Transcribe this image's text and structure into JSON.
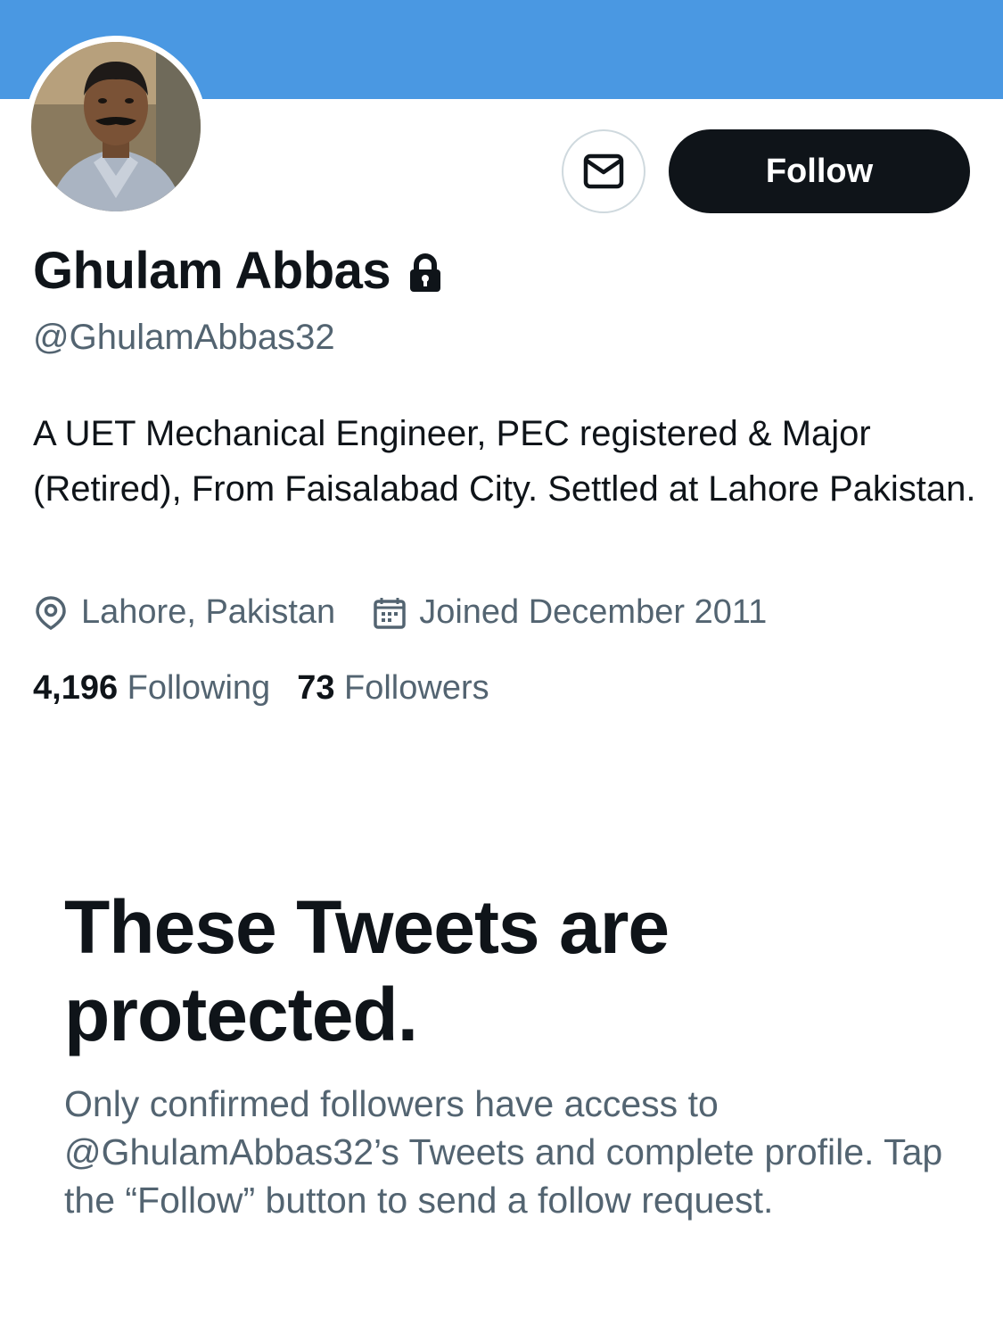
{
  "profile": {
    "name": "Ghulam Abbas",
    "handle": "@GhulamAbbas32",
    "bio": "A UET Mechanical Engineer, PEC registered & Major (Retired), From Faisalabad City. Settled at Lahore Pakistan.",
    "location": "Lahore, Pakistan",
    "joined": "Joined December 2011",
    "following_count": "4,196",
    "following_label": "Following",
    "followers_count": "73",
    "followers_label": "Followers",
    "protected": true
  },
  "actions": {
    "follow_label": "Follow",
    "message_icon": "envelope-icon"
  },
  "protected_notice": {
    "title": "These Tweets are protected.",
    "description": "Only confirmed followers have access to @GhulamAbbas32’s Tweets and complete profile. Tap the “Follow” button to send a follow request."
  },
  "colors": {
    "banner": "#4a98e2",
    "primary_text": "#0f1419",
    "secondary_text": "#536471",
    "follow_button": "#0f1419"
  }
}
